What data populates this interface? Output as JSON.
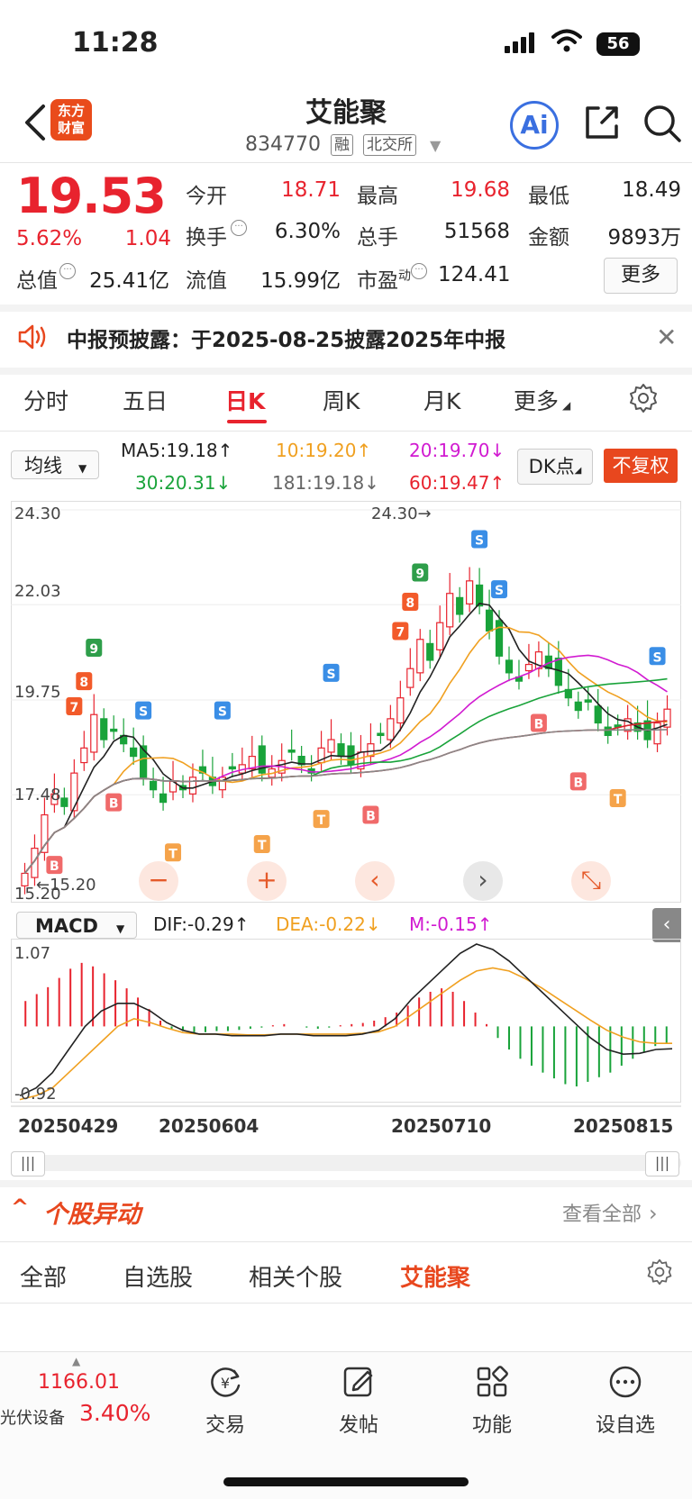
{
  "status": {
    "time": "11:28",
    "battery": "56"
  },
  "header": {
    "logo_line1": "东方",
    "logo_line2": "财富",
    "stock_name": "艾能聚",
    "stock_code": "834770",
    "tag_margin": "融",
    "tag_exchange": "北交所",
    "ai_label": "Ai"
  },
  "quote": {
    "price": "19.53",
    "change_pct": "5.62%",
    "change_amt": "1.04",
    "fields": {
      "open_label": "今开",
      "open": "18.71",
      "high_label": "最高",
      "high": "19.68",
      "low_label": "最低",
      "low": "18.49",
      "turnover_label": "换手",
      "turnover": "6.30%",
      "volume_label": "总手",
      "volume": "51568",
      "amount_label": "金额",
      "amount": "9893万",
      "mktcap_label": "总值",
      "mktcap": "25.41亿",
      "float_label": "流值",
      "float": "15.99亿",
      "pe_label": "市盈",
      "pe_sup": "动",
      "pe": "124.41"
    },
    "more_label": "更多"
  },
  "notice": {
    "text": "中报预披露：于2025-08-25披露2025年中报"
  },
  "tabs": [
    "分时",
    "五日",
    "日K",
    "周K",
    "月K",
    "更多"
  ],
  "active_tab": "日K",
  "ma": {
    "select_label": "均线",
    "ma5": "MA5:19.18↑",
    "ma10": "10:19.20↑",
    "ma20": "20:19.70↓",
    "ma30": "30:20.31↓",
    "ma181": "181:19.18↓",
    "ma60": "60:19.47↑",
    "dk_label": "DK点",
    "fuquan_label": "不复权"
  },
  "chart_data": [
    {
      "type": "candlestick",
      "ylim": [
        15.2,
        24.3
      ],
      "y_ticks": [
        "24.30",
        "22.03",
        "19.75",
        "17.48",
        "15.20"
      ],
      "max_annotation": "24.30",
      "min_annotation": "15.20",
      "x_ticks": [
        "20250429",
        "20250604",
        "20250710",
        "20250815"
      ],
      "ma_colors": {
        "ma5": "#222222",
        "ma10": "#f0a020",
        "ma20": "#d11ad1",
        "ma30": "#19a33a",
        "ma60": "#d8232e",
        "ma181": "#888888"
      },
      "close_series": [
        15.6,
        16.2,
        17.0,
        17.5,
        17.2,
        18.0,
        18.6,
        19.4,
        18.8,
        19.0,
        18.7,
        18.4,
        17.9,
        17.6,
        17.3,
        17.8,
        17.6,
        17.9,
        18.0,
        17.7,
        17.9,
        18.1,
        18.2,
        18.4,
        18.0,
        18.1,
        18.3,
        18.5,
        18.2,
        18.0,
        18.6,
        18.8,
        18.4,
        18.2,
        18.5,
        18.7,
        18.9,
        19.3,
        19.8,
        20.5,
        21.2,
        20.7,
        21.6,
        22.3,
        21.8,
        22.6,
        22.0,
        21.4,
        20.8,
        20.4,
        20.2,
        20.6,
        20.9,
        20.5,
        20.1,
        19.8,
        19.5,
        19.7,
        19.2,
        18.9,
        19.1,
        19.3,
        19.0,
        18.8,
        19.2,
        19.53
      ],
      "signals": [
        {
          "label": "7",
          "kind": "num"
        },
        {
          "label": "8",
          "kind": "num"
        },
        {
          "label": "9",
          "kind": "nine"
        },
        {
          "label": "S",
          "kind": "sell"
        },
        {
          "label": "B",
          "kind": "buy"
        },
        {
          "label": "T",
          "kind": "t"
        }
      ]
    },
    {
      "type": "bar",
      "name": "MACD",
      "ylim": [
        -0.92,
        1.07
      ],
      "y_ticks": [
        "1.07",
        "-0.92"
      ],
      "values": [
        0.22,
        0.28,
        0.34,
        0.42,
        0.5,
        0.55,
        0.52,
        0.46,
        0.4,
        0.33,
        0.25,
        0.15,
        0.05,
        -0.02,
        -0.04,
        -0.05,
        -0.05,
        -0.04,
        -0.04,
        -0.03,
        -0.02,
        -0.01,
        0.01,
        0.02,
        0.0,
        -0.01,
        -0.02,
        -0.01,
        0.01,
        0.02,
        0.03,
        0.05,
        0.08,
        0.12,
        0.18,
        0.25,
        0.3,
        0.33,
        0.3,
        0.22,
        0.12,
        0.02,
        -0.1,
        -0.2,
        -0.28,
        -0.34,
        -0.4,
        -0.45,
        -0.5,
        -0.52,
        -0.48,
        -0.44,
        -0.4,
        -0.34,
        -0.28,
        -0.22,
        -0.17,
        -0.15
      ],
      "dif": [
        -0.9,
        -0.8,
        -0.6,
        -0.3,
        0.0,
        0.2,
        0.3,
        0.3,
        0.2,
        0.05,
        -0.05,
        -0.1,
        -0.1,
        -0.12,
        -0.12,
        -0.12,
        -0.1,
        -0.1,
        -0.12,
        -0.12,
        -0.12,
        -0.1,
        -0.05,
        0.1,
        0.35,
        0.55,
        0.75,
        0.95,
        1.07,
        1.0,
        0.85,
        0.65,
        0.45,
        0.25,
        0.05,
        -0.15,
        -0.3,
        -0.36,
        -0.35,
        -0.3,
        -0.29
      ],
      "dea": [
        -0.95,
        -0.9,
        -0.8,
        -0.6,
        -0.4,
        -0.2,
        0.0,
        0.1,
        0.05,
        -0.02,
        -0.08,
        -0.1,
        -0.1,
        -0.1,
        -0.11,
        -0.11,
        -0.1,
        -0.1,
        -0.1,
        -0.1,
        -0.1,
        -0.09,
        -0.07,
        0.0,
        0.15,
        0.3,
        0.45,
        0.6,
        0.72,
        0.76,
        0.72,
        0.62,
        0.5,
        0.36,
        0.22,
        0.08,
        -0.05,
        -0.14,
        -0.2,
        -0.22,
        -0.22
      ],
      "legend": {
        "dif": "DIF:-0.29↑",
        "dea": "DEA:-0.22↓",
        "m": "M:-0.15↑"
      },
      "select_label": "MACD"
    }
  ],
  "section": {
    "title": "个股异动",
    "see_all": "查看全部"
  },
  "subtabs": [
    "全部",
    "自选股",
    "相关个股",
    "艾能聚"
  ],
  "active_subtab": "艾能聚",
  "bottom_nav": {
    "index_value": "1166.01",
    "index_name": "光伏设备",
    "index_pct": "3.40%",
    "items": [
      "交易",
      "发帖",
      "功能",
      "设自选"
    ]
  }
}
